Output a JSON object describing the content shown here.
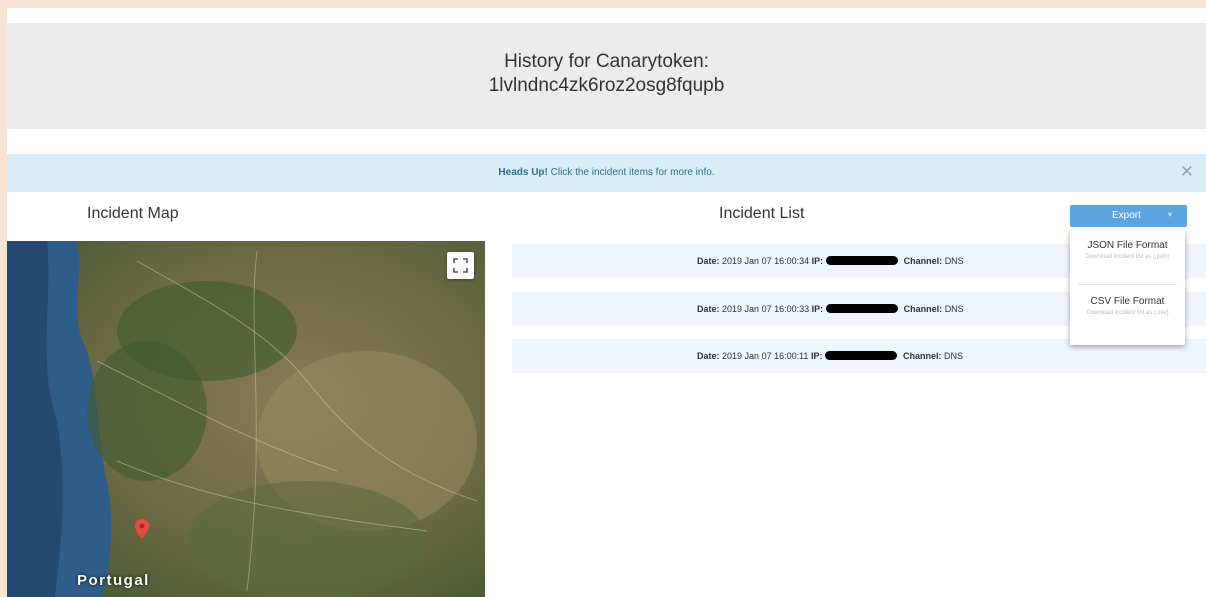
{
  "header": {
    "title_line1": "History for Canarytoken:",
    "title_line2": "1lvlndnc4zk6roz2osg8fqupb"
  },
  "alert": {
    "bold": "Heads Up!",
    "text": " Click the incident items for more info.",
    "close_glyph": "✕"
  },
  "map": {
    "title": "Incident Map",
    "country_label": "Portugal",
    "fullscreen_icon": "fullscreen-icon",
    "marker_icon": "map-pin-icon"
  },
  "list": {
    "title": "Incident List",
    "export": {
      "label": "Export",
      "caret": "▾"
    },
    "export_menu": [
      {
        "title": "JSON File Format",
        "desc": "Download incident list as (.json)"
      },
      {
        "title": "CSV File Format",
        "desc": "Download incident list as (.csv)"
      }
    ],
    "date_label": "Date:",
    "ip_label": "IP:",
    "channel_label": "Channel:",
    "incidents": [
      {
        "date": "2019 Jan 07 16:00:34",
        "channel": "DNS"
      },
      {
        "date": "2019 Jan 07 16:00:33",
        "channel": "DNS"
      },
      {
        "date": "2019 Jan 07 16:00:11",
        "channel": "DNS"
      }
    ]
  }
}
